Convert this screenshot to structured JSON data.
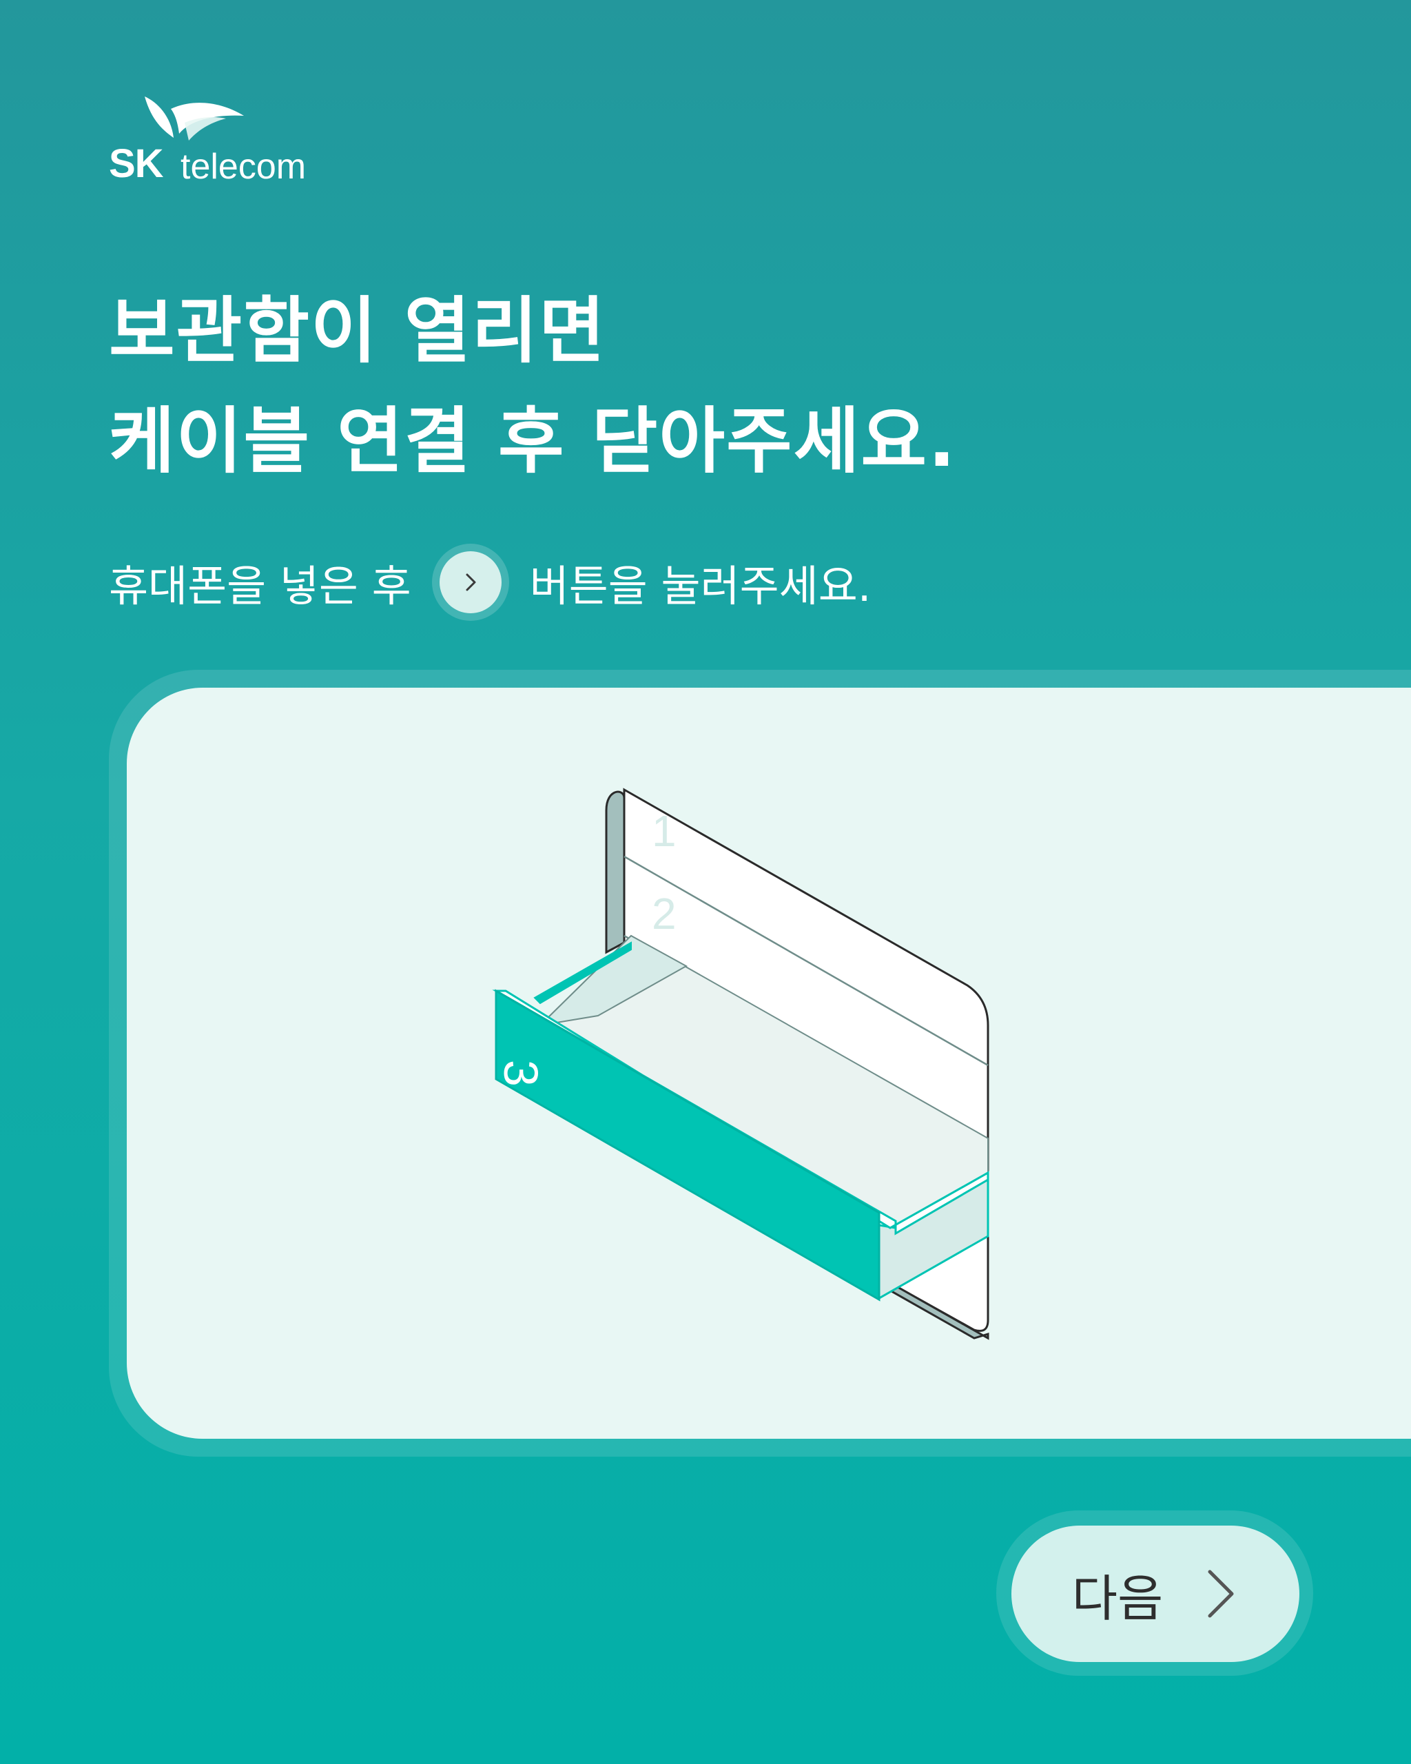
{
  "brand": {
    "sk": "SK",
    "telecom": "telecom"
  },
  "headline": {
    "line1": "보관함이 열리면",
    "line2": "케이블 연결 후 닫아주세요."
  },
  "subtitle": {
    "before": "휴대폰을 넣은 후",
    "after": "버튼을 눌러주세요.",
    "inline_icon": "chevron-right-icon"
  },
  "locker": {
    "drawer_numbers": [
      "1",
      "2",
      "3"
    ],
    "open_drawer": "3"
  },
  "next_button": {
    "label": "다음",
    "icon": "chevron-right-icon"
  },
  "colors": {
    "accent": "#00c4b3",
    "background_top": "#23979c",
    "background_bottom": "#02b0a8",
    "card": "#e8f7f4",
    "button": "#d3f1ed"
  }
}
